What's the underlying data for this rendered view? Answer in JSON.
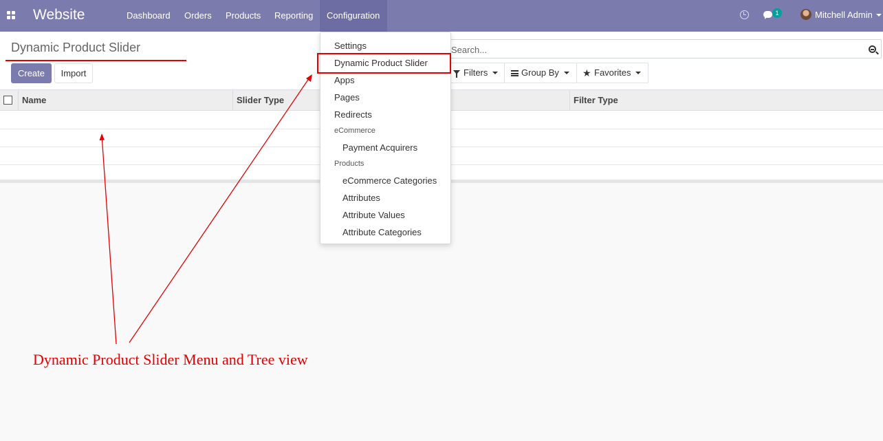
{
  "navbar": {
    "brand": "Website",
    "menu": [
      "Dashboard",
      "Orders",
      "Products",
      "Reporting",
      "Configuration"
    ],
    "active_menu": "Configuration",
    "chat_badge": "1",
    "user_name": "Mitchell Admin"
  },
  "control_panel": {
    "breadcrumb": "Dynamic Product Slider",
    "create_label": "Create",
    "import_label": "Import",
    "search_placeholder": "Search...",
    "filters_label": "Filters",
    "group_by_label": "Group By",
    "favorites_label": "Favorites"
  },
  "table": {
    "columns": [
      "Name",
      "Slider Type",
      "Filter Type"
    ],
    "empty_rows": 4
  },
  "dropdown": {
    "items": [
      {
        "type": "item",
        "label": "Settings"
      },
      {
        "type": "item",
        "label": "Dynamic Product Slider",
        "highlighted": true
      },
      {
        "type": "item",
        "label": "Apps"
      },
      {
        "type": "item",
        "label": "Pages"
      },
      {
        "type": "item",
        "label": "Redirects"
      },
      {
        "type": "header",
        "label": "eCommerce"
      },
      {
        "type": "sub",
        "label": "Payment Acquirers"
      },
      {
        "type": "header",
        "label": "Products"
      },
      {
        "type": "sub",
        "label": "eCommerce Categories"
      },
      {
        "type": "sub",
        "label": "Attributes"
      },
      {
        "type": "sub",
        "label": "Attribute Values"
      },
      {
        "type": "sub",
        "label": "Attribute Categories"
      }
    ]
  },
  "annotation": {
    "text": "Dynamic Product Slider Menu and Tree view",
    "color": "#e30000"
  },
  "colors": {
    "navbar": "#7c7bad",
    "primary_button": "#7c7bad",
    "badge": "#00a09d"
  }
}
